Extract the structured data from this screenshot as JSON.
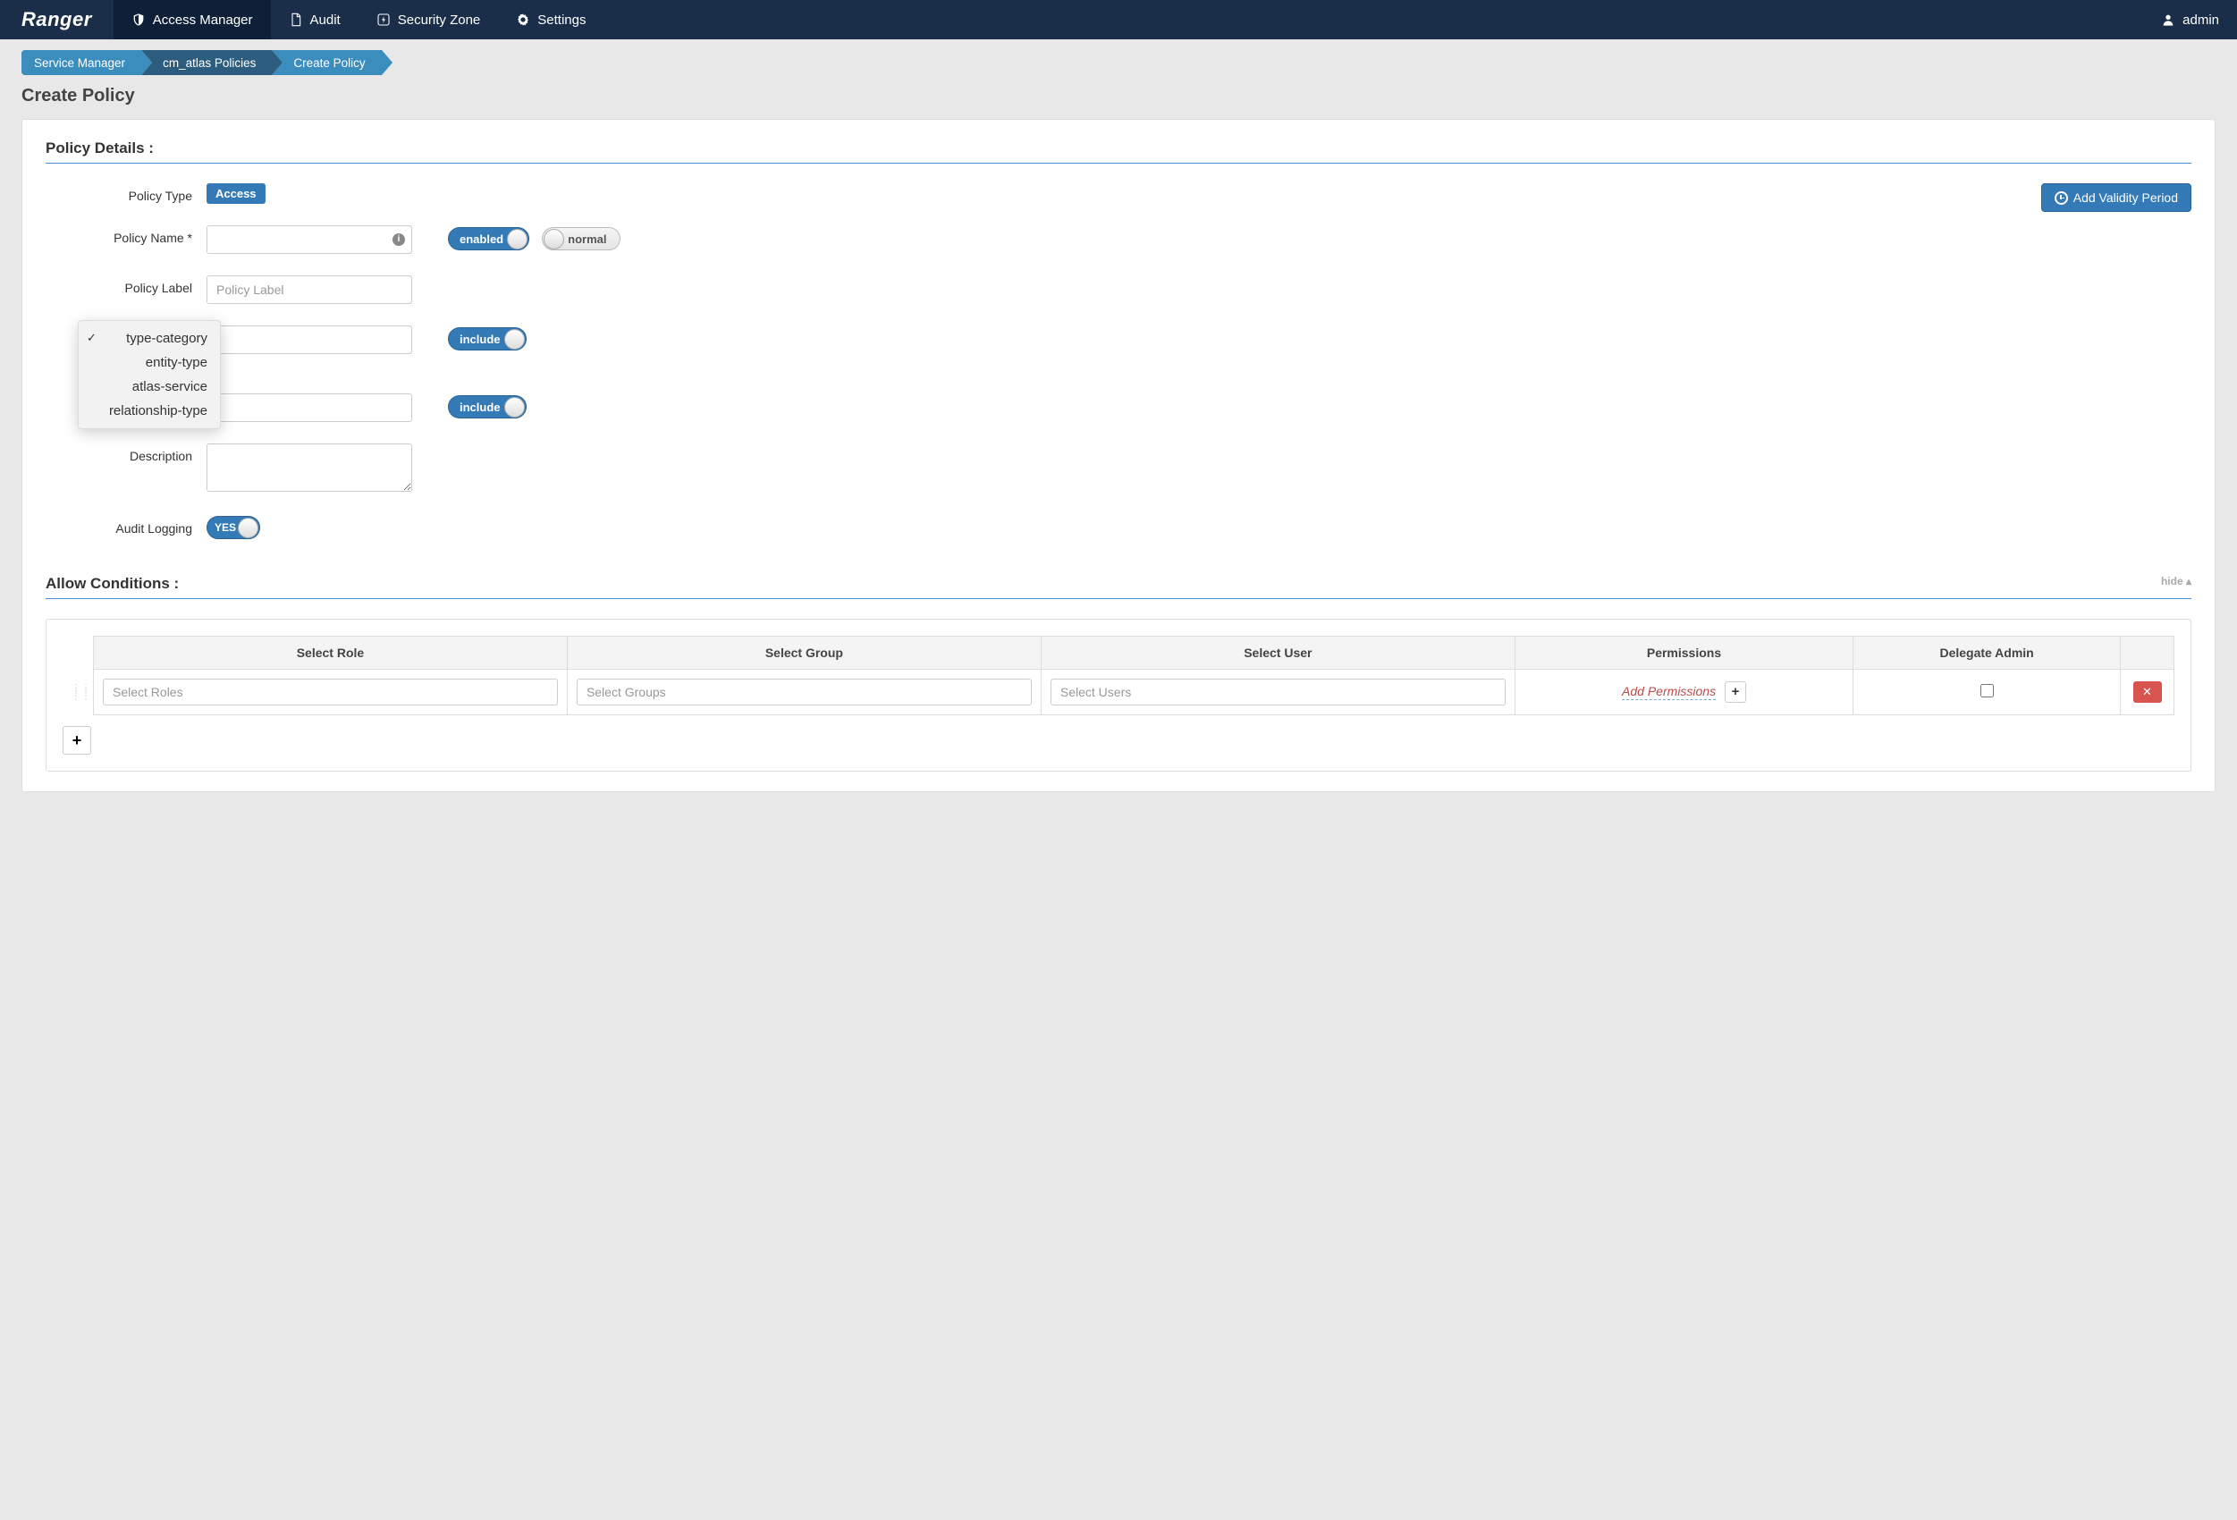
{
  "navbar": {
    "brand": "Ranger",
    "items": [
      {
        "label": "Access Manager",
        "icon": "shield-icon",
        "active": true
      },
      {
        "label": "Audit",
        "icon": "file-icon",
        "active": false
      },
      {
        "label": "Security Zone",
        "icon": "bolt-icon",
        "active": false
      },
      {
        "label": "Settings",
        "icon": "gear-icon",
        "active": false
      }
    ],
    "user": "admin"
  },
  "breadcrumb": [
    "Service Manager",
    "cm_atlas Policies",
    "Create Policy"
  ],
  "page_title": "Create Policy",
  "section_title": "Policy Details :",
  "validity_btn": "Add Validity Period",
  "form": {
    "policy_type_label": "Policy Type",
    "policy_type_value": "Access",
    "policy_name_label": "Policy Name *",
    "policy_name_value": "",
    "enabled_label": "enabled",
    "normal_label": "normal",
    "policy_label_label": "Policy Label",
    "policy_label_placeholder": "Policy Label",
    "policy_label_value": "",
    "include1": "include",
    "include2": "include",
    "description_label": "Description",
    "description_value": "",
    "audit_label": "Audit Logging",
    "audit_value": "YES"
  },
  "dropdown_items": [
    "type-category",
    "entity-type",
    "atlas-service",
    "relationship-type"
  ],
  "dropdown_selected": 0,
  "allow_section_title": "Allow Conditions :",
  "hide_label": "hide",
  "table": {
    "headers": [
      "Select Role",
      "Select Group",
      "Select User",
      "Permissions",
      "Delegate Admin"
    ],
    "placeholders": {
      "roles": "Select Roles",
      "groups": "Select Groups",
      "users": "Select Users"
    },
    "add_permissions": "Add Permissions"
  }
}
